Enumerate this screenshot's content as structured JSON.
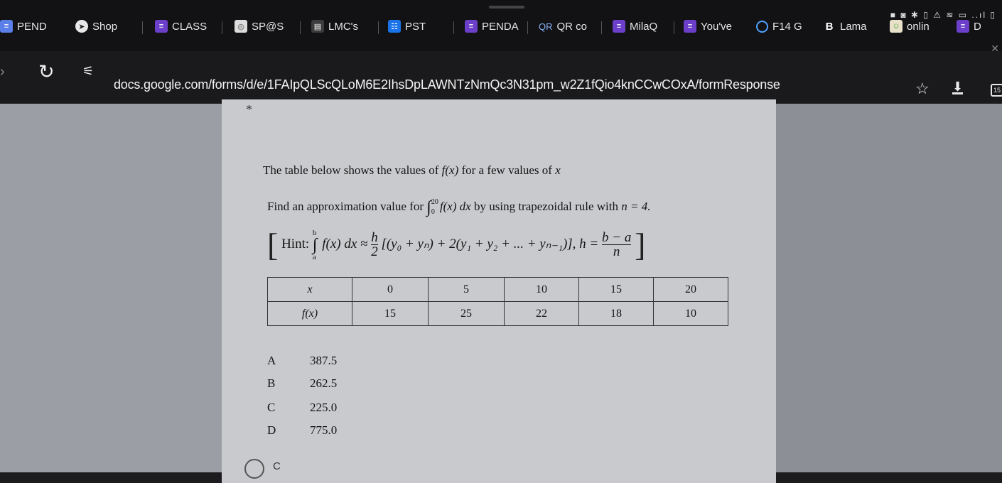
{
  "status_icons": "■ ◙ ✱ ▯ ⚠ ≋ ▭ ..ıl ▯",
  "tabs": [
    {
      "label": "PEND",
      "icon": "list-icon"
    },
    {
      "label": "Shop",
      "icon": "globe-icon"
    },
    {
      "label": "CLASS",
      "icon": "form-icon"
    },
    {
      "label": "SP@S",
      "icon": "app-icon"
    },
    {
      "label": "LMC's",
      "icon": "thumbnail-icon"
    },
    {
      "label": "PST",
      "icon": "doc-icon"
    },
    {
      "label": "PENDA",
      "icon": "form-icon"
    },
    {
      "label": "QR co",
      "icon": "qr-icon"
    },
    {
      "label": "MilaQ",
      "icon": "form-icon"
    },
    {
      "label": "You've",
      "icon": "form-icon"
    },
    {
      "label": "F14 G",
      "icon": "ring-icon"
    },
    {
      "label": "Lama",
      "icon": "bold-b-icon"
    },
    {
      "label": "onlin",
      "icon": "face-icon"
    },
    {
      "label": "D",
      "icon": "form-icon"
    }
  ],
  "address": {
    "url": "docs.google.com/forms/d/e/1FAIpQLScQLoM6E2IhsDpLAWNTzNmQc3N31pm_w2Z1fQio4knCCwCOxA/formResponse",
    "tab_count": "15"
  },
  "question": {
    "required_marker": "*",
    "intro_pre": "The table below shows the values of ",
    "intro_fx": "f(x)",
    "intro_post": " for a few values of ",
    "intro_x": "x",
    "find_pre": "Find an approximation value for ",
    "lower": "0",
    "upper": "20",
    "integrand": "f(x) dx",
    "find_mid": " by using trapezoidal rule with ",
    "n_value": "n = 4.",
    "hint_label": "Hint: ",
    "hint_lower": "a",
    "hint_upper": "b",
    "hint_integrand": "f(x) dx ≈ ",
    "h_num": "h",
    "h_den": "2",
    "hint_formula": "[(y₀ + yₙ) + 2(y₁ + y₂ + ... + yₙ₋₁)],",
    "h_eq": " h = ",
    "ba_num": "b − a",
    "ba_den": "n"
  },
  "table": {
    "row_x_label": "x",
    "row_f_label": "f(x)",
    "x": [
      "0",
      "5",
      "10",
      "15",
      "20"
    ],
    "f": [
      "15",
      "25",
      "22",
      "18",
      "10"
    ]
  },
  "options": [
    {
      "letter": "A",
      "value": "387.5"
    },
    {
      "letter": "B",
      "value": "262.5"
    },
    {
      "letter": "C",
      "value": "225.0"
    },
    {
      "letter": "D",
      "value": "775.0"
    }
  ],
  "answer": {
    "label": "C"
  }
}
